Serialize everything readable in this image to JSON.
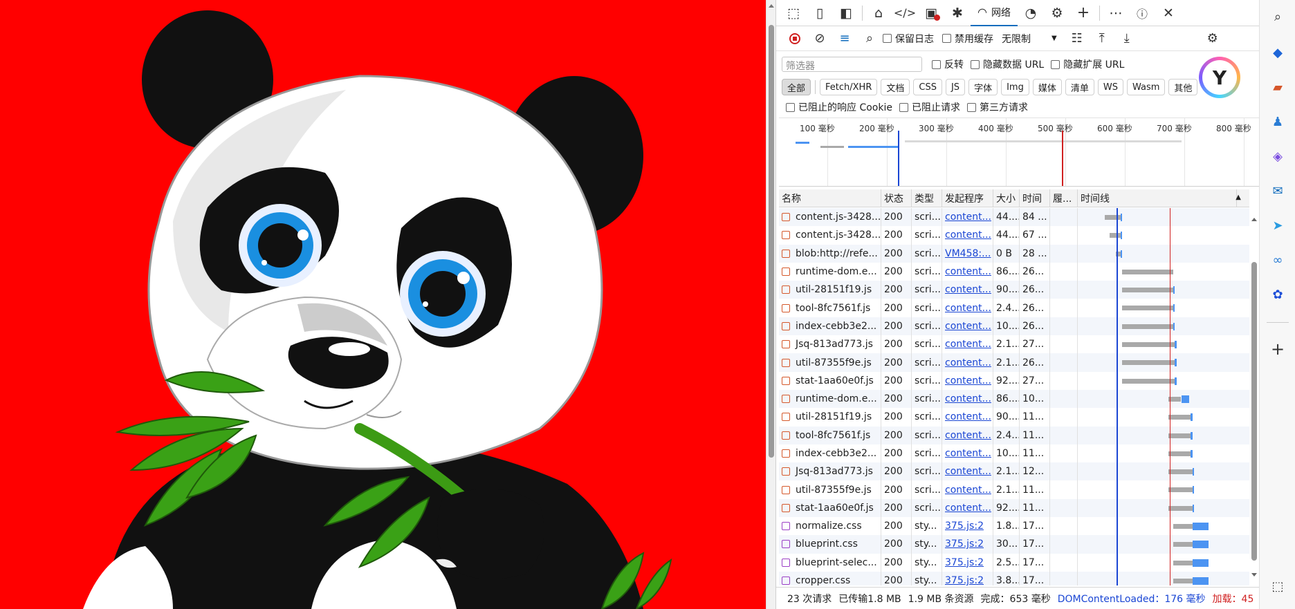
{
  "devtools": {
    "tabs": {
      "network_label": "网络"
    },
    "toolbar": {
      "preserve_log": "保留日志",
      "disable_cache": "禁用缓存",
      "throttle": "无限制"
    },
    "filter": {
      "placeholder": "筛选器",
      "invert": "反转",
      "hide_data_url": "隐藏数据 URL",
      "hide_ext_url": "隐藏扩展 URL"
    },
    "types": [
      "全部",
      "Fetch/XHR",
      "文档",
      "CSS",
      "JS",
      "字体",
      "Img",
      "媒体",
      "清单",
      "WS",
      "Wasm",
      "其他"
    ],
    "blocking": {
      "blocked_cookies": "已阻止的响应 Cookie",
      "blocked_requests": "已阻止请求",
      "third_party": "第三方请求"
    },
    "overview_labels": [
      "100 毫秒",
      "200 毫秒",
      "300 毫秒",
      "400 毫秒",
      "500 毫秒",
      "600 毫秒",
      "700 毫秒",
      "800 毫秒"
    ],
    "columns": [
      "名称",
      "状态",
      "类型",
      "发起程序",
      "大小",
      "时间",
      "履...",
      "时间线"
    ],
    "rows": [
      {
        "name": "content.js-3428...",
        "status": "200",
        "type": "scri...",
        "initiator": "content...",
        "size": "44....",
        "time": "84 ...",
        "kind": "js",
        "bar_start": 0.17,
        "bar_len": 0.1,
        "recv": 0.01
      },
      {
        "name": "content.js-3428...",
        "status": "200",
        "type": "scri...",
        "initiator": "content...",
        "size": "44....",
        "time": "67 ...",
        "kind": "js",
        "bar_start": 0.2,
        "bar_len": 0.07,
        "recv": 0.01
      },
      {
        "name": "blob:http://refe...",
        "status": "200",
        "type": "scri...",
        "initiator": "VM458:...",
        "size": "0 B",
        "time": "28 ...",
        "kind": "js",
        "bar_start": 0.24,
        "bar_len": 0.03,
        "recv": 0.01
      },
      {
        "name": "runtime-dom.e...",
        "status": "200",
        "type": "scri...",
        "initiator": "content...",
        "size": "86....",
        "time": "26...",
        "kind": "js",
        "bar_start": 0.28,
        "bar_len": 0.32,
        "recv": 0.0
      },
      {
        "name": "util-28151f19.js",
        "status": "200",
        "type": "scri...",
        "initiator": "content...",
        "size": "90....",
        "time": "26...",
        "kind": "js",
        "bar_start": 0.28,
        "bar_len": 0.32,
        "recv": 0.01
      },
      {
        "name": "tool-8fc7561f.js",
        "status": "200",
        "type": "scri...",
        "initiator": "content...",
        "size": "2.4....",
        "time": "26...",
        "kind": "js",
        "bar_start": 0.28,
        "bar_len": 0.32,
        "recv": 0.01
      },
      {
        "name": "index-cebb3e2...",
        "status": "200",
        "type": "scri...",
        "initiator": "content...",
        "size": "10....",
        "time": "26...",
        "kind": "js",
        "bar_start": 0.28,
        "bar_len": 0.32,
        "recv": 0.01
      },
      {
        "name": "Jsq-813ad773.js",
        "status": "200",
        "type": "scri...",
        "initiator": "content...",
        "size": "2.1....",
        "time": "27...",
        "kind": "js",
        "bar_start": 0.28,
        "bar_len": 0.33,
        "recv": 0.01
      },
      {
        "name": "util-87355f9e.js",
        "status": "200",
        "type": "scri...",
        "initiator": "content...",
        "size": "2.1....",
        "time": "26...",
        "kind": "js",
        "bar_start": 0.28,
        "bar_len": 0.33,
        "recv": 0.01
      },
      {
        "name": "stat-1aa60e0f.js",
        "status": "200",
        "type": "scri...",
        "initiator": "content...",
        "size": "92....",
        "time": "27...",
        "kind": "js",
        "bar_start": 0.28,
        "bar_len": 0.33,
        "recv": 0.01
      },
      {
        "name": "runtime-dom.e...",
        "status": "200",
        "type": "scri...",
        "initiator": "content...",
        "size": "86....",
        "time": "10...",
        "kind": "js",
        "bar_start": 0.57,
        "bar_len": 0.08,
        "recv": 0.05
      },
      {
        "name": "util-28151f19.js",
        "status": "200",
        "type": "scri...",
        "initiator": "content...",
        "size": "90....",
        "time": "11...",
        "kind": "js",
        "bar_start": 0.57,
        "bar_len": 0.14,
        "recv": 0.01
      },
      {
        "name": "tool-8fc7561f.js",
        "status": "200",
        "type": "scri...",
        "initiator": "content...",
        "size": "2.4....",
        "time": "11...",
        "kind": "js",
        "bar_start": 0.57,
        "bar_len": 0.14,
        "recv": 0.01
      },
      {
        "name": "index-cebb3e2...",
        "status": "200",
        "type": "scri...",
        "initiator": "content...",
        "size": "10....",
        "time": "11...",
        "kind": "js",
        "bar_start": 0.57,
        "bar_len": 0.14,
        "recv": 0.01
      },
      {
        "name": "Jsq-813ad773.js",
        "status": "200",
        "type": "scri...",
        "initiator": "content...",
        "size": "2.1....",
        "time": "12...",
        "kind": "js",
        "bar_start": 0.57,
        "bar_len": 0.15,
        "recv": 0.01
      },
      {
        "name": "util-87355f9e.js",
        "status": "200",
        "type": "scri...",
        "initiator": "content...",
        "size": "2.1....",
        "time": "11...",
        "kind": "js",
        "bar_start": 0.57,
        "bar_len": 0.15,
        "recv": 0.01
      },
      {
        "name": "stat-1aa60e0f.js",
        "status": "200",
        "type": "scri...",
        "initiator": "content...",
        "size": "92....",
        "time": "11...",
        "kind": "js",
        "bar_start": 0.57,
        "bar_len": 0.15,
        "recv": 0.01
      },
      {
        "name": "normalize.css",
        "status": "200",
        "type": "sty...",
        "initiator": "375.js:2",
        "size": "1.8...",
        "time": "17...",
        "kind": "css",
        "bar_start": 0.6,
        "bar_len": 0.12,
        "recv": 0.1
      },
      {
        "name": "blueprint.css",
        "status": "200",
        "type": "sty...",
        "initiator": "375.js:2",
        "size": "30...",
        "time": "17...",
        "kind": "css",
        "bar_start": 0.6,
        "bar_len": 0.12,
        "recv": 0.1
      },
      {
        "name": "blueprint-selec...",
        "status": "200",
        "type": "sty...",
        "initiator": "375.js:2",
        "size": "2.5...",
        "time": "17...",
        "kind": "css",
        "bar_start": 0.6,
        "bar_len": 0.12,
        "recv": 0.1
      },
      {
        "name": "cropper.css",
        "status": "200",
        "type": "sty...",
        "initiator": "375.js:2",
        "size": "3.8...",
        "time": "17...",
        "kind": "css",
        "bar_start": 0.6,
        "bar_len": 0.12,
        "recv": 0.1
      }
    ],
    "status": {
      "requests": "23 次请求",
      "transferred": "已传输1.8 MB",
      "resources": "1.9 MB 条资源",
      "finish": "完成：653 毫秒",
      "dcl": "DOMContentLoaded：176 毫秒",
      "load": "加载：45"
    }
  },
  "colors": {
    "viewport_bg": "#ff0000",
    "accent": "#0f6cbd",
    "link": "#1a46d4",
    "dcl_line": "#1a46d4",
    "load_line": "#d02020"
  }
}
